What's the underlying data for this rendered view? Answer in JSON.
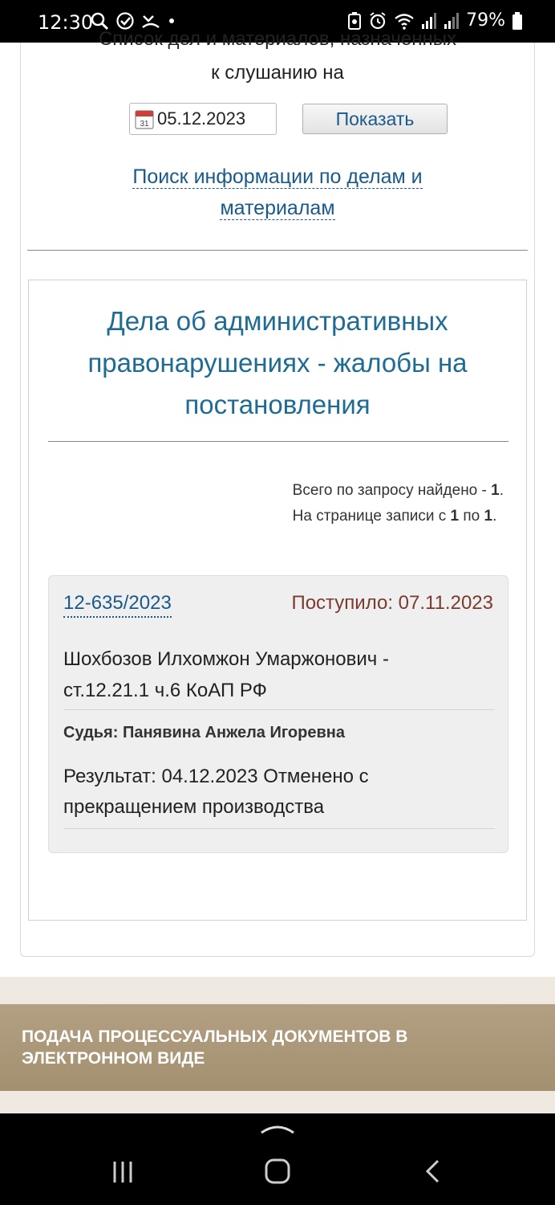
{
  "status_bar": {
    "time": "12:30",
    "battery": "79%"
  },
  "intro": {
    "line1": "Список дел и материалов, назначенных",
    "line2": "к слушанию на"
  },
  "date_field": {
    "value": "05.12.2023",
    "calendar_day": "31"
  },
  "show_button": {
    "label": "Показать"
  },
  "search_link": {
    "line1": "Поиск информации по делам и",
    "line2": "материалам"
  },
  "section": {
    "title_line1": "Дела об административных",
    "title_line2": "правонарушениях - жалобы на",
    "title_line3": "постановления",
    "found_prefix": "Всего по запросу найдено - ",
    "found_count": "1",
    "found_suffix": ".",
    "page_prefix": "На странице записи с ",
    "page_from": "1",
    "page_mid": " по ",
    "page_to": "1",
    "page_suffix": "."
  },
  "case": {
    "number": "12-635/2023",
    "received": "Поступило: 07.11.2023",
    "party_line1": "Шохбозов Илхомжон Умаржонович -",
    "party_line2": "ст.12.21.1 ч.6 КоАП РФ",
    "judge": "Судья: Панявина Анжела Игоревна",
    "result_line1": "Результат: 04.12.2023 Отменено с",
    "result_line2": "прекращением производства"
  },
  "footer": {
    "line1": "ПОДАЧА ПРОЦЕССУАЛЬНЫХ ДОКУМЕНТОВ В",
    "line2": "ЭЛЕКТРОННОМ ВИДЕ"
  },
  "colors": {
    "link": "#1a5a8a",
    "title": "#1e6b93",
    "received": "#7a3b2e",
    "banner": "#a3906f"
  }
}
